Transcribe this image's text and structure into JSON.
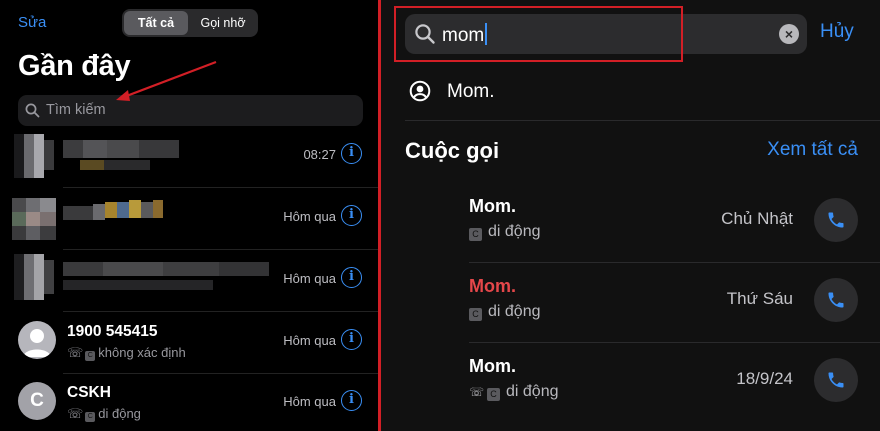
{
  "left": {
    "edit_label": "Sửa",
    "segment": {
      "all": "Tất cả",
      "missed": "Gọi nhỡ"
    },
    "title": "Gần đây",
    "search_placeholder": "Tìm kiếm",
    "rows": [
      {
        "name": "",
        "time": "08:27"
      },
      {
        "name": "",
        "time": "Hôm qua"
      },
      {
        "name": "",
        "time": "Hôm qua"
      },
      {
        "name": "1900 545415",
        "sub": "không xác định",
        "time": "Hôm qua"
      },
      {
        "name": "CSKH",
        "avatar_letter": "C",
        "sub": "di động",
        "time": "Hôm qua"
      }
    ],
    "info_glyph": "i",
    "tag_glyph": "C"
  },
  "right": {
    "search_query": "mom",
    "clear_glyph": "×",
    "cancel_label": "Hủy",
    "contact_name": "Mom.",
    "section_title": "Cuộc gọi",
    "see_all_label": "Xem tất cả",
    "calls": [
      {
        "name": "Mom.",
        "type": "di động",
        "date": "Chủ Nhật",
        "missed": false
      },
      {
        "name": "Mom.",
        "type": "di động",
        "date": "Thứ Sáu",
        "missed": true
      },
      {
        "name": "Mom.",
        "type": "di động",
        "date": "18/9/24",
        "missed": false
      }
    ],
    "tag_glyph": "C"
  },
  "colors": {
    "accent": "#3a8ff5",
    "highlight": "#d21f26",
    "missed": "#e5474a"
  },
  "icons": [
    "search-icon",
    "info-icon",
    "person-circle-icon",
    "phone-icon",
    "clear-icon",
    "outgoing-call-icon",
    "red-arrow-annotation"
  ]
}
